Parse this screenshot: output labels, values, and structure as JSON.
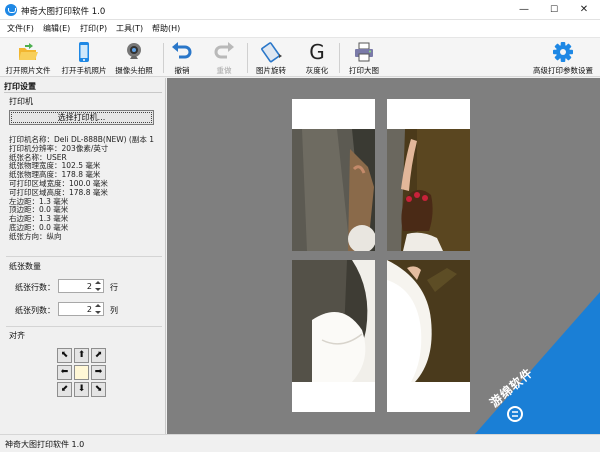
{
  "window": {
    "title": "神奇大图打印软件 1.0",
    "min": "—",
    "max": "☐",
    "close": "✕"
  },
  "menu": [
    "文件(F)",
    "编辑(E)",
    "打印(P)",
    "工具(T)",
    "帮助(H)"
  ],
  "toolbar": {
    "open_photo": "打开照片文件",
    "open_phone": "打开手机照片",
    "camera": "摄像头拍照",
    "undo": "撤销",
    "redo": "重做",
    "rotate": "图片旋转",
    "gray": "灰度化",
    "print_big": "打印大图",
    "advanced": "高级打印参数设置",
    "gray_glyph": "G"
  },
  "panel": {
    "title": "打印设置",
    "printer_group": "打印机",
    "select_printer": "选择打印机...",
    "info": [
      "打印机名称：Deli DL-888B(NEW) (副本 1",
      "打印机分辨率：203像素/英寸",
      "纸张名称：USER",
      "纸张物理宽度：102.5 毫米",
      "纸张物理高度：178.8 毫米",
      "可打印区域宽度：100.0 毫米",
      "可打印区域高度：178.8 毫米",
      "左边距：1.3 毫米",
      "顶边距：0.0 毫米",
      "右边距：1.3 毫米",
      "底边距：0.0 毫米",
      "纸张方向：纵向"
    ],
    "paper_group": "纸张数量",
    "rows_label": "纸张行数：",
    "rows_value": "2",
    "rows_unit": "行",
    "cols_label": "纸张列数：",
    "cols_value": "2",
    "cols_unit": "列",
    "align_group": "对齐",
    "align": {
      "top_left": "⬉",
      "top": "⬆",
      "top_right": "⬈",
      "left": "⬅",
      "center": "",
      "right": "➡",
      "bottom_left": "⬋",
      "bottom": "⬇",
      "bottom_right": "⬊"
    }
  },
  "status": "神奇大图打印软件 1.0",
  "watermark": "游绵软件",
  "colors": {
    "accent": "#1e88e5",
    "canvas": "#7f7f7f",
    "watermark": "#1a7fd6"
  }
}
